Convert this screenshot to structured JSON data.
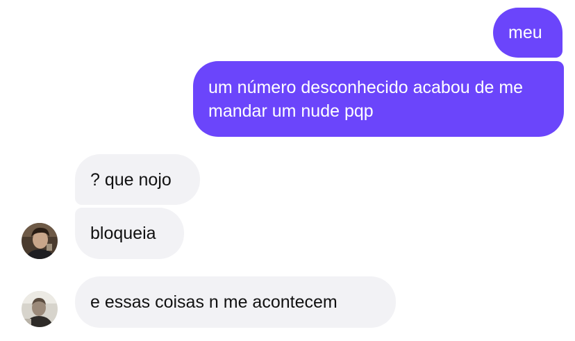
{
  "messages": [
    {
      "sender": "me",
      "text": "meu"
    },
    {
      "sender": "me",
      "text": "um número desconhecido acabou de me mandar um nude pqp",
      "lines": [
        "um número desconhecido acabou de me",
        "mandar um nude pqp"
      ]
    },
    {
      "sender": "contact_1",
      "text": "? que nojo"
    },
    {
      "sender": "contact_1",
      "text": "bloqueia"
    },
    {
      "sender": "contact_2",
      "text": "e essas coisas n me acontecem"
    }
  ],
  "colors": {
    "sent_bubble": "#6b45fb",
    "received_bubble": "#f2f2f5",
    "sent_text": "#ffffff",
    "received_text": "#111111"
  },
  "avatars": [
    {
      "sender": "contact_1",
      "icon": "profile-photo"
    },
    {
      "sender": "contact_2",
      "icon": "profile-photo"
    }
  ]
}
